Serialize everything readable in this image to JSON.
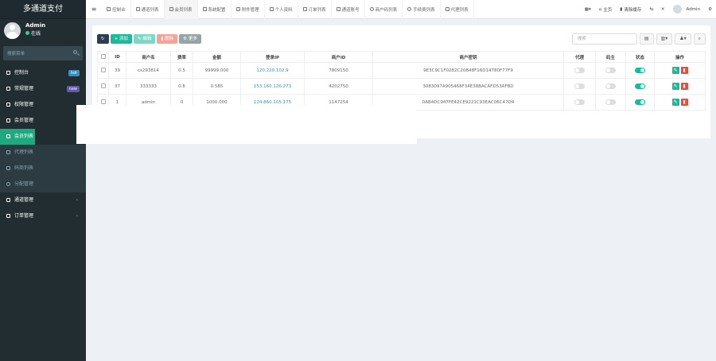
{
  "sidebar": {
    "logo": "多通道支付",
    "user": {
      "name": "Admin",
      "status": "在线"
    },
    "search_placeholder": "搜索菜单",
    "items": [
      {
        "label": "控制台",
        "badge": "hot",
        "badge_color": "#3c8dbc"
      },
      {
        "label": "常规管理",
        "badge": "new",
        "badge_color": "#605ca8"
      },
      {
        "label": "权限管理",
        "badge": "",
        "badge_color": ""
      },
      {
        "label": "会员管理",
        "badge": "",
        "badge_color": ""
      },
      {
        "label": "会员列表",
        "badge": "",
        "badge_color": ""
      },
      {
        "label": "代理列表",
        "badge": "",
        "badge_color": ""
      },
      {
        "label": "码商列表",
        "badge": "",
        "badge_color": ""
      },
      {
        "label": "分配管理",
        "badge": "",
        "badge_color": ""
      },
      {
        "label": "通道管理",
        "badge": "",
        "badge_color": ""
      },
      {
        "label": "订单管理",
        "badge": "",
        "badge_color": ""
      }
    ]
  },
  "topbar": {
    "menu_icon": "hamburger-icon",
    "tabs": [
      {
        "label": "控制台"
      },
      {
        "label": "通道列表"
      },
      {
        "label": "会员列表"
      },
      {
        "label": "系统配置"
      },
      {
        "label": "附件管理"
      },
      {
        "label": "个人资料"
      },
      {
        "label": "订单列表"
      },
      {
        "label": "通道账号"
      },
      {
        "label": "商户码列表"
      },
      {
        "label": "手续费列表"
      },
      {
        "label": "代理列表"
      }
    ],
    "home": "主页",
    "clear_cache": "清除缓存",
    "username": "Admin"
  },
  "toolbar": {
    "add": "添加",
    "edit": "编辑",
    "delete": "删除",
    "more": "更多",
    "search_placeholder": "搜索",
    "colors": {
      "refresh": "#2c3e50",
      "add": "#18bc9c",
      "edit": "#7ed7c6",
      "delete": "#f3a39a",
      "more": "#95a5a6"
    }
  },
  "table": {
    "headers": [
      "ID",
      "商户名",
      "费率",
      "金额",
      "登录IP",
      "商户ID",
      "商户密钥",
      "代理",
      "码主",
      "状态",
      "操作"
    ],
    "rows": [
      {
        "id": "39",
        "name": "cs293814",
        "rate": "0.5",
        "amount": "99999.000",
        "ip": "120.220.102.9",
        "mid": "7809150",
        "key": "9E3C9C1F0282C20B48F16D14780F77F9",
        "agent": false,
        "owner": false,
        "status": true
      },
      {
        "id": "37",
        "name": "333333",
        "rate": "0.6",
        "amount": "0.585",
        "ip": "153.160.126.273",
        "mid": "4202750",
        "key": "3083097A905468F34E38BACAFD53AFBD",
        "agent": false,
        "owner": false,
        "status": true
      },
      {
        "id": "1",
        "name": "admin",
        "rate": "0",
        "amount": "1000.000",
        "ip": "124.860.105.175",
        "mid": "1147254",
        "key": "0AB4DC947FE42CE9221C93EAC06C47D4",
        "agent": false,
        "owner": false,
        "status": true
      }
    ]
  }
}
